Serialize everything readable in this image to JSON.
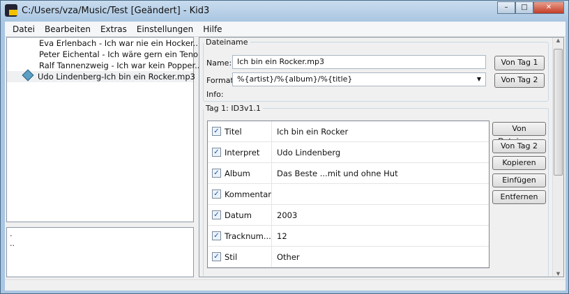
{
  "window": {
    "title": "C:/Users/vza/Music/Test [Geändert] - Kid3",
    "minimize": "–",
    "maximize": "□",
    "close": "✕"
  },
  "menu": [
    "Datei",
    "Bearbeiten",
    "Extras",
    "Einstellungen",
    "Hilfe"
  ],
  "files": [
    "Eva Erlenbach - Ich war nie ein Hocker....",
    "Peter Eichental - Ich wäre gern ein Tenor...",
    "Ralf Tannenzweig - Ich war kein Popper....",
    "Udo Lindenberg-Ich bin ein Rocker.mp3"
  ],
  "dirs": [
    ".",
    ".."
  ],
  "filename": {
    "legend": "Dateiname",
    "name_label": "Name:",
    "name_value": "Ich bin ein Rocker.mp3",
    "format_label": "Format:",
    "format_value": "%{artist}/%{album}/%{title}",
    "info_label": "Info:",
    "btn_tag1": "Von Tag 1",
    "btn_tag2": "Von Tag 2"
  },
  "tag1": {
    "legend": "Tag 1: ID3v1.1",
    "rows": [
      {
        "field": "Titel",
        "value": "Ich bin ein Rocker"
      },
      {
        "field": "Interpret",
        "value": "Udo Lindenberg"
      },
      {
        "field": "Album",
        "value": "Das Beste ...mit und ohne Hut"
      },
      {
        "field": "Kommentar",
        "value": ""
      },
      {
        "field": "Datum",
        "value": "2003"
      },
      {
        "field": "Tracknum...",
        "value": "12"
      },
      {
        "field": "Stil",
        "value": "Other"
      }
    ],
    "buttons": [
      "Von Dateiname",
      "Von Tag 2",
      "Kopieren",
      "Einfügen",
      "Entfernen"
    ]
  }
}
